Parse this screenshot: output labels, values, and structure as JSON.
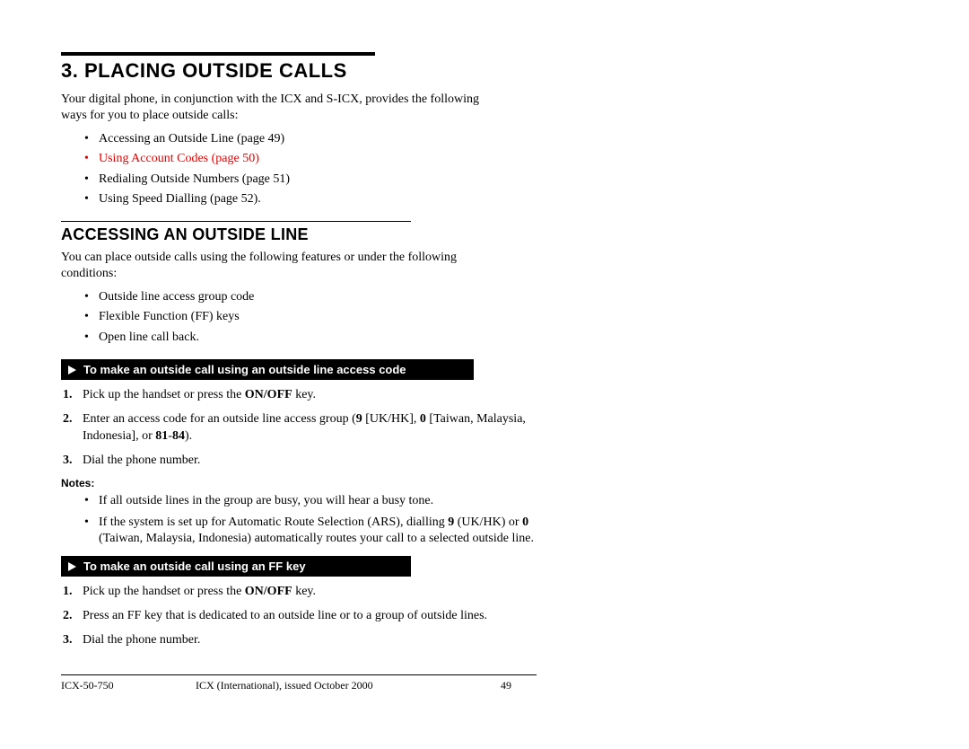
{
  "h1": "3. Placing Outside Calls",
  "intro1a": "Your digital phone, in conjunction with the ICX and S-ICX, provides the following",
  "intro1b": "ways for you to place outside calls:",
  "list1": [
    "Accessing an Outside Line (page 49)",
    "Using Account Codes (page 50)",
    "Redialing Outside Numbers (page 51)",
    "Using Speed Dialling (page 52)."
  ],
  "h2": "Accessing an Outside Line",
  "intro2a": "You can place outside calls using the following features or under the following",
  "intro2b": "conditions:",
  "list2": [
    "Outside line access group code",
    "Flexible Function (FF) keys",
    "Open line call back."
  ],
  "bar1": "To make an outside call using an outside line access code",
  "steps1": {
    "s1a": "Pick up the handset or press the ",
    "s1b": "ON/OFF",
    "s1c": " key.",
    "s2a": "Enter an access code for an outside line access group (",
    "s2b": "9",
    "s2c": " [UK/HK], ",
    "s2d": "0",
    "s2e": " [Taiwan, Malaysia, Indonesia], or ",
    "s2f": "81",
    "s2g": "-",
    "s2h": "84",
    "s2i": ").",
    "s3": "Dial the phone number."
  },
  "notesLabel": "Notes:",
  "notes": {
    "n1": "If all outside lines in the group are busy, you will hear a busy tone.",
    "n2a": "If the system is set up for Automatic Route Selection (ARS), dialling ",
    "n2b": "9",
    "n2c": " (UK/HK) or ",
    "n2d": "0",
    "n2e": " (Taiwan, Malaysia, Indonesia) automatically routes your call to a selected outside line."
  },
  "bar2": "To make an outside call using an FF key",
  "steps2": {
    "s1a": "Pick up the handset or press the ",
    "s1b": "ON/OFF",
    "s1c": " key.",
    "s2": "Press an FF key that is dedicated to an outside line or to a group of outside lines.",
    "s3": "Dial the phone number."
  },
  "footer": {
    "left": "ICX-50-750",
    "mid": "ICX (International), issued October 2000",
    "page": "49"
  }
}
